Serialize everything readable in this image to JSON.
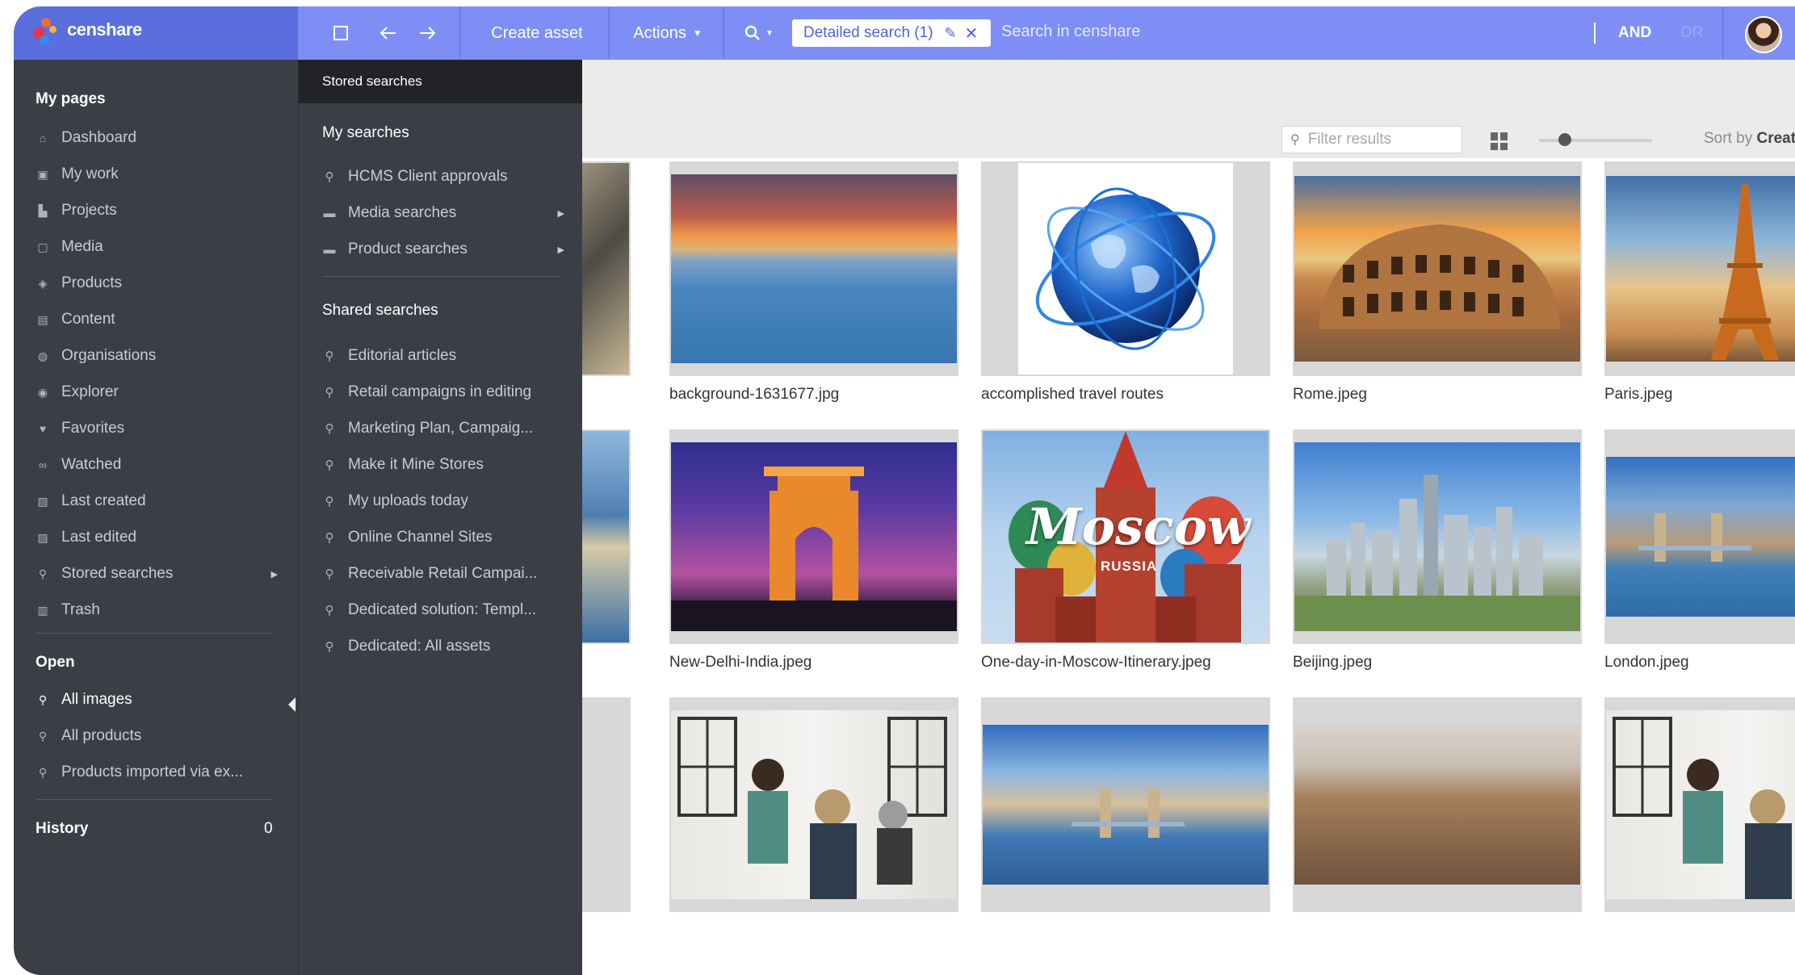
{
  "app": {
    "brand": "censhare"
  },
  "toolbar": {
    "create_asset": "Create asset",
    "actions": "Actions",
    "search_chip": "Detailed search (1)",
    "search_placeholder": "Search in censhare",
    "and_label": "AND",
    "or_label": "OR"
  },
  "left_nav": {
    "my_pages_heading": "My pages",
    "items": [
      {
        "label": "Dashboard",
        "icon": "home-icon"
      },
      {
        "label": "My work",
        "icon": "inbox-icon"
      },
      {
        "label": "Projects",
        "icon": "projects-icon"
      },
      {
        "label": "Media",
        "icon": "media-icon"
      },
      {
        "label": "Products",
        "icon": "box-icon"
      },
      {
        "label": "Content",
        "icon": "document-icon"
      },
      {
        "label": "Organisations",
        "icon": "globe-icon"
      },
      {
        "label": "Explorer",
        "icon": "compass-icon"
      },
      {
        "label": "Favorites",
        "icon": "heart-icon"
      },
      {
        "label": "Watched",
        "icon": "binoculars-icon"
      },
      {
        "label": "Last created",
        "icon": "created-icon"
      },
      {
        "label": "Last edited",
        "icon": "edited-icon"
      },
      {
        "label": "Stored searches",
        "icon": "search-icon"
      },
      {
        "label": "Trash",
        "icon": "trash-icon"
      }
    ],
    "open_heading": "Open",
    "open_items": [
      {
        "label": "All images"
      },
      {
        "label": "All products"
      },
      {
        "label": "Products imported via ex..."
      }
    ],
    "history_heading": "History",
    "history_count": "0"
  },
  "stored_panel": {
    "title": "Stored searches",
    "my_searches_heading": "My searches",
    "my_searches": [
      {
        "label": "HCMS Client approvals",
        "icon": "search-icon"
      },
      {
        "label": "Media searches",
        "icon": "folder-icon"
      },
      {
        "label": "Product searches",
        "icon": "folder-icon"
      }
    ],
    "shared_heading": "Shared searches",
    "shared_searches": [
      {
        "label": "Editorial articles"
      },
      {
        "label": "Retail campaigns in editing"
      },
      {
        "label": "Marketing Plan, Campaig..."
      },
      {
        "label": "Make it Mine Stores"
      },
      {
        "label": "My uploads today"
      },
      {
        "label": "Online Channel Sites"
      },
      {
        "label": "Receivable Retail Campai..."
      },
      {
        "label": "Dedicated solution: Templ..."
      },
      {
        "label": "Dedicated: All assets"
      }
    ]
  },
  "content": {
    "filter_placeholder": "Filter results",
    "sort_prefix": "Sort by ",
    "sort_value": "Created",
    "assets": [
      {
        "caption": "background-1631677.jpg"
      },
      {
        "caption": "accomplished travel routes"
      },
      {
        "caption": "Rome.jpeg"
      },
      {
        "caption": "Paris.jpeg"
      },
      {
        "caption": "New-Delhi-India.jpeg"
      },
      {
        "caption": "One-day-in-Moscow-Itinerary.jpeg"
      },
      {
        "caption": "Beijing.jpeg"
      },
      {
        "caption": "London.jpeg"
      }
    ],
    "moscow_text": "Moscow",
    "russia_text": "RUSSIA"
  },
  "colors": {
    "topbar": "#7f8ef5",
    "brand_bg": "#5a6ede",
    "sidebar": "#3b3e45"
  }
}
